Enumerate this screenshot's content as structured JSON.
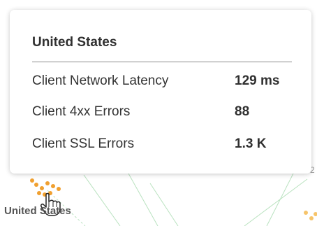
{
  "tooltip": {
    "title": "United States",
    "metrics": [
      {
        "label": "Client Network Latency",
        "value": "129 ms"
      },
      {
        "label": "Client 4xx Errors",
        "value": "88"
      },
      {
        "label": "Client SSL Errors",
        "value": "1.3 K"
      }
    ]
  },
  "map": {
    "region_label": "United States",
    "edge_digit": "2",
    "marker_color": "#f0a030",
    "line_color": "#9fd6a8"
  }
}
